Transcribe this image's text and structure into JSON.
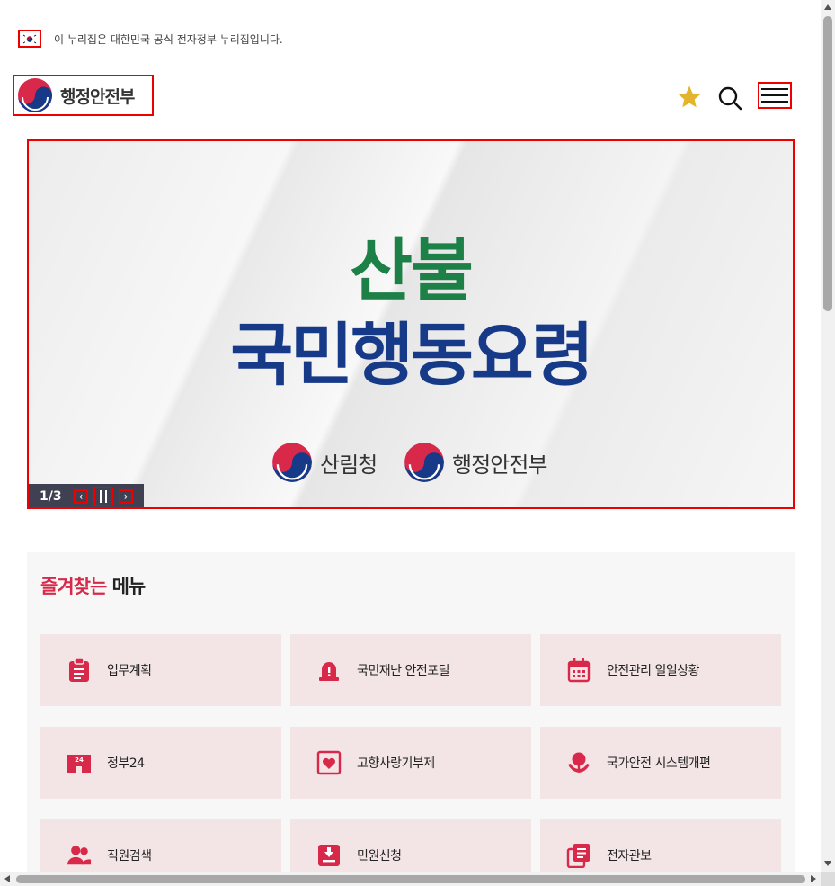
{
  "gov_banner": {
    "text": "이 누리집은 대한민국 공식 전자정부 누리집입니다."
  },
  "header": {
    "logo_text": "행정안전부",
    "star_color": "#e3b52f",
    "icons": [
      "star-icon",
      "search-icon",
      "menu-icon"
    ]
  },
  "banner": {
    "line1": "산불",
    "line2": "국민행동요령",
    "line1_color": "#1c8047",
    "line2_color": "#163a88",
    "org1": "산림청",
    "org2": "행정안전부",
    "slide_counter": "1/3",
    "prev_label": "‹",
    "next_label": "›"
  },
  "favorites": {
    "title_point": "즐겨찾는",
    "title_rest": " 메뉴",
    "accent_color": "#d8294a",
    "tile_bg": "#f3e4e6",
    "items": [
      {
        "label": "업무계획",
        "icon": "clipboard-icon"
      },
      {
        "label": "국민재난 안전포털",
        "icon": "alarm-icon"
      },
      {
        "label": "안전관리 일일상황",
        "icon": "calendar-icon"
      },
      {
        "label": "정부24",
        "icon": "building-24-icon"
      },
      {
        "label": "고향사랑기부제",
        "icon": "heart-card-icon"
      },
      {
        "label": "국가안전 시스템개편",
        "icon": "tree-hands-icon"
      },
      {
        "label": "직원검색",
        "icon": "people-icon"
      },
      {
        "label": "민원신청",
        "icon": "inbox-download-icon"
      },
      {
        "label": "전자관보",
        "icon": "documents-icon"
      }
    ]
  }
}
